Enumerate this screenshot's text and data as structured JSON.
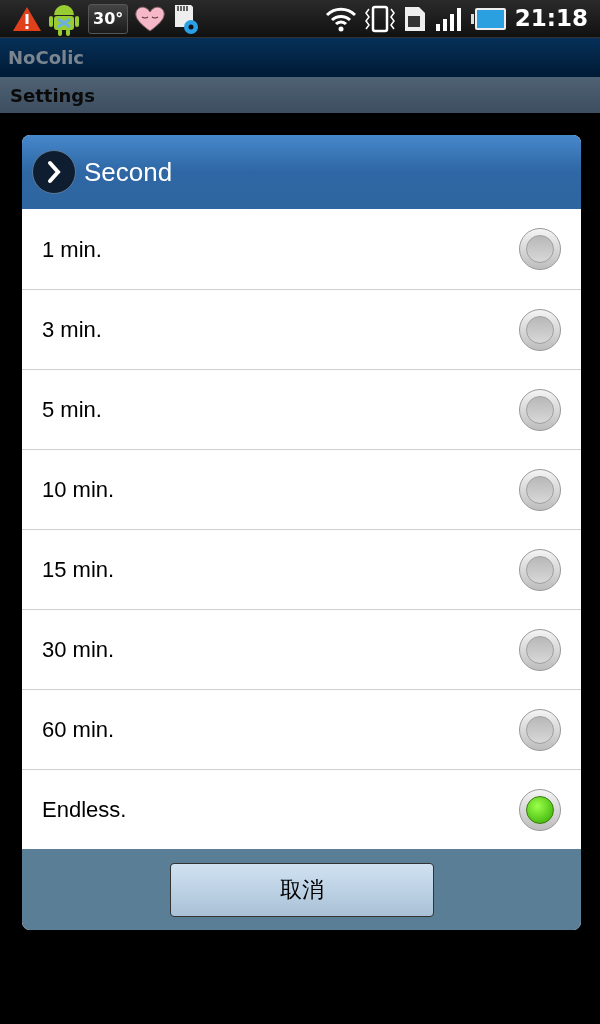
{
  "status_bar": {
    "temperature": "30°",
    "time": "21:18"
  },
  "app_title": "NoColic",
  "section_title": "Settings",
  "dialog": {
    "title": "Second",
    "options": [
      {
        "label": "1 min.",
        "selected": false
      },
      {
        "label": "3 min.",
        "selected": false
      },
      {
        "label": "5 min.",
        "selected": false
      },
      {
        "label": "10 min.",
        "selected": false
      },
      {
        "label": "15 min.",
        "selected": false
      },
      {
        "label": "30 min.",
        "selected": false
      },
      {
        "label": "60 min.",
        "selected": false
      },
      {
        "label": "Endless.",
        "selected": true
      }
    ],
    "cancel_button": "取消"
  }
}
